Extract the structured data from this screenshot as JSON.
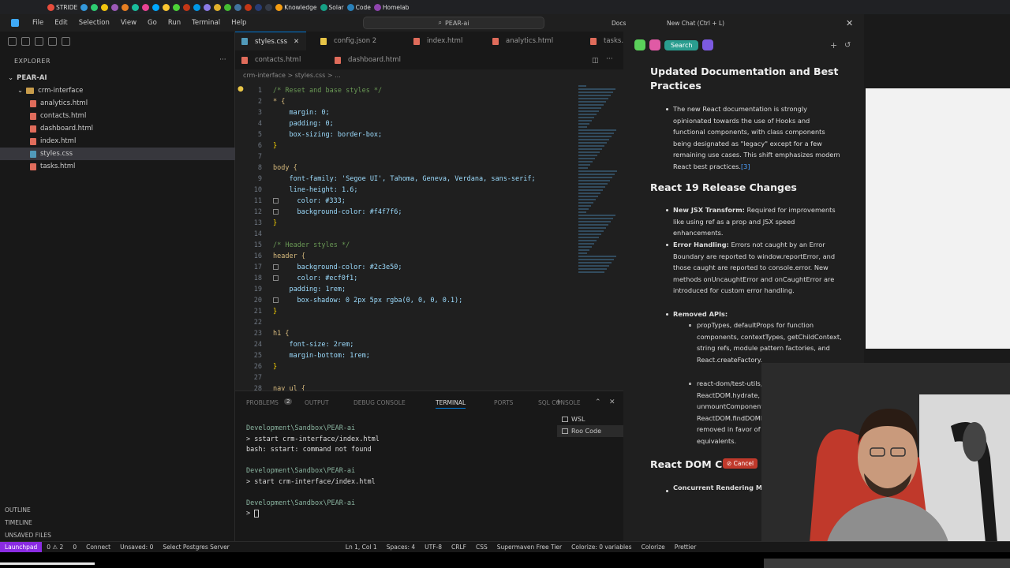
{
  "bookmarks": [
    "STRIDE",
    "",
    "",
    "",
    "",
    "",
    "",
    "",
    "",
    "",
    "",
    "",
    "",
    "",
    "",
    "",
    "",
    "",
    "",
    "",
    "Knowledge",
    "Solar",
    "Code",
    "Homelab"
  ],
  "menu": [
    "File",
    "Edit",
    "Selection",
    "View",
    "Go",
    "Run",
    "Terminal",
    "Help"
  ],
  "title_search": "PEAR-ai",
  "title_right": [
    "Docs",
    "New Chat (Ctrl + L)"
  ],
  "explorer": {
    "header": "EXPLORER",
    "root": "PEAR-AI",
    "folder": "crm-interface",
    "files": [
      "analytics.html",
      "contacts.html",
      "dashboard.html",
      "index.html",
      "styles.css",
      "tasks.html"
    ],
    "selected_index": 4,
    "bottom": [
      "OUTLINE",
      "TIMELINE",
      "UNSAVED FILES"
    ]
  },
  "tabs_row1": [
    "styles.css",
    "config.json 2",
    "index.html",
    "analytics.html",
    "tasks.html"
  ],
  "tabs_row2": [
    "contacts.html",
    "dashboard.html"
  ],
  "breadcrumb": "crm-interface  >  styles.css  >  ...",
  "code_lines": [
    {
      "n": "1",
      "t": "/* Reset and base styles */",
      "k": "com"
    },
    {
      "n": "2",
      "t": "* {",
      "k": "sel"
    },
    {
      "n": "3",
      "t": "    margin: 0;",
      "k": "prop"
    },
    {
      "n": "4",
      "t": "    padding: 0;",
      "k": "prop"
    },
    {
      "n": "5",
      "t": "    box-sizing: border-box;",
      "k": "prop"
    },
    {
      "n": "6",
      "t": "}",
      "k": "pun"
    },
    {
      "n": "7",
      "t": "",
      "k": "pun"
    },
    {
      "n": "8",
      "t": "body {",
      "k": "sel"
    },
    {
      "n": "9",
      "t": "    font-family: 'Segoe UI', Tahoma, Geneva, Verdana, sans-serif;",
      "k": "prop"
    },
    {
      "n": "10",
      "t": "    line-height: 1.6;",
      "k": "prop"
    },
    {
      "n": "11",
      "t": "    color: #333;",
      "k": "prop"
    },
    {
      "n": "12",
      "t": "    background-color: #f4f7f6;",
      "k": "prop"
    },
    {
      "n": "13",
      "t": "}",
      "k": "pun"
    },
    {
      "n": "14",
      "t": "",
      "k": "pun"
    },
    {
      "n": "15",
      "t": "/* Header styles */",
      "k": "com"
    },
    {
      "n": "16",
      "t": "header {",
      "k": "sel"
    },
    {
      "n": "17",
      "t": "    background-color: #2c3e50;",
      "k": "prop"
    },
    {
      "n": "18",
      "t": "    color: #ecf0f1;",
      "k": "prop"
    },
    {
      "n": "19",
      "t": "    padding: 1rem;",
      "k": "prop"
    },
    {
      "n": "20",
      "t": "    box-shadow: 0 2px 5px rgba(0, 0, 0, 0.1);",
      "k": "prop"
    },
    {
      "n": "21",
      "t": "}",
      "k": "pun"
    },
    {
      "n": "22",
      "t": "",
      "k": "pun"
    },
    {
      "n": "23",
      "t": "h1 {",
      "k": "sel"
    },
    {
      "n": "24",
      "t": "    font-size: 2rem;",
      "k": "prop"
    },
    {
      "n": "25",
      "t": "    margin-bottom: 1rem;",
      "k": "prop"
    },
    {
      "n": "26",
      "t": "}",
      "k": "pun"
    },
    {
      "n": "27",
      "t": "",
      "k": "pun"
    },
    {
      "n": "28",
      "t": "nav ul {",
      "k": "sel"
    }
  ],
  "panel": {
    "tabs": [
      "PROBLEMS",
      "OUTPUT",
      "DEBUG CONSOLE",
      "TERMINAL",
      "PORTS",
      "SQL CONSOLE"
    ],
    "problems_count": "2",
    "active_tab": "TERMINAL",
    "terminal_lines": [
      "Development\\Sandbox\\PEAR-ai",
      "> sstart crm-interface/index.html",
      "bash: sstart: command not found",
      "",
      "Development\\Sandbox\\PEAR-ai",
      "> start crm-interface/index.html",
      "",
      "Development\\Sandbox\\PEAR-ai",
      ">"
    ],
    "terminals": [
      "WSL",
      "Roo Code"
    ]
  },
  "status": [
    "Launchpad",
    "0 ⚠ 2",
    "0",
    "Connect",
    "Unsaved: 0",
    "Select Postgres Server",
    "Ln 1, Col 1",
    "Spaces: 4",
    "UTF-8",
    "CRLF",
    "CSS",
    "Supermaven Free Tier",
    "Colorize: 0 variables",
    "Colorize",
    "Prettier"
  ],
  "chat": {
    "search_label": "Search",
    "h1": "Updated Documentation and Best Practices",
    "p1": "The new React documentation is strongly opinionated towards the use of Hooks and functional components, with class components being designated as \"legacy\" except for a few remaining use cases. This shift emphasizes modern React best practices.",
    "p1_link": "[3]",
    "h2": "React 19 Release Changes",
    "b1_title": "New JSX Transform:",
    "b1_text": "Required for improvements like using ref as a prop and JSX speed enhancements.",
    "b2_title": "Error Handling:",
    "b2_text": "Errors not caught by an Error Boundary are reported to window.reportError, and those caught are reported to console.error. New methods onUncaughtError and onCaughtError are introduced for custom error handling.",
    "b3_title": "Removed APIs:",
    "s1": "propTypes, defaultProps for function components, contextTypes, getChildContext, string refs, module pattern factories, and React.createFactory.",
    "s2": "react-dom/test-utils, ReactDOM.render, ReactDOM.hydrate, unmountComponentAtNode, and ReactDOM.findDOMNode are replaced or removed in favor of concurrent equivalents.",
    "h3": "React DOM C",
    "cancel": "Cancel",
    "b4_title": "Concurrent Rendering Methods:"
  },
  "colors": {
    "accent": "#0078d4",
    "remote": "#8a2be2",
    "error": "#e5534b"
  }
}
